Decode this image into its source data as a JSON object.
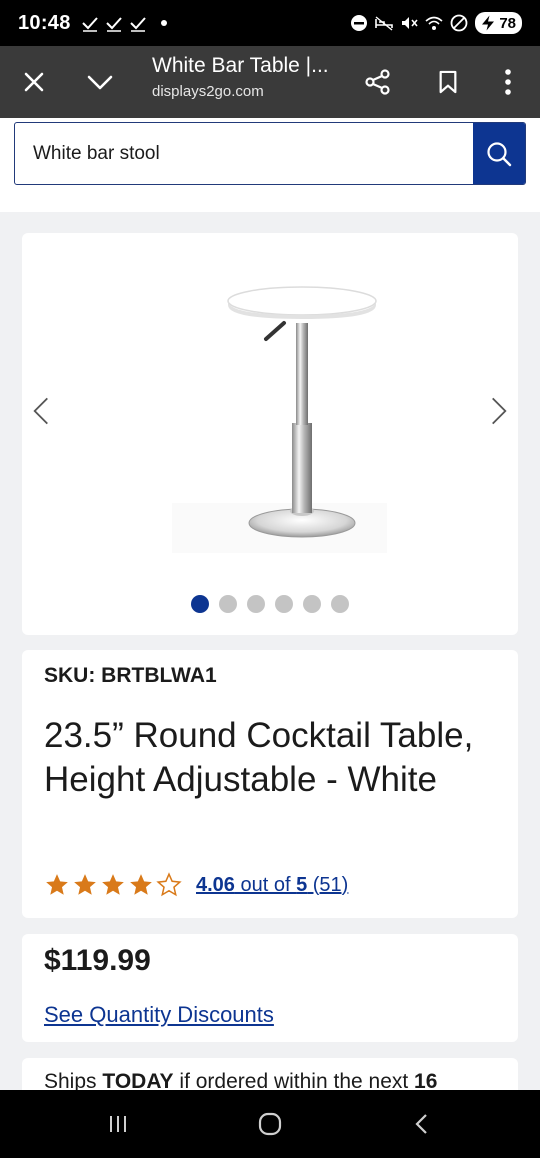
{
  "status_bar": {
    "time": "10:48",
    "battery": "78"
  },
  "tab_header": {
    "title": "White Bar Table |...",
    "url": "displays2go.com"
  },
  "search": {
    "value": "White bar stool",
    "icon": "search-icon"
  },
  "gallery": {
    "image_count": 6,
    "active_index": 0
  },
  "product": {
    "sku": "SKU: BRTBLWA1",
    "title": "23.5” Round Cocktail Table, Height Adjustable - White",
    "rating_value": "4.06",
    "rating_mid": " out of ",
    "rating_max": "5",
    "rating_count": " (51)",
    "rating_numeric": 4.06
  },
  "pricing": {
    "price": "$119.99",
    "discount_link": "See Quantity Discounts"
  },
  "shipping": {
    "prefix": "Ships ",
    "emphasis": "TODAY",
    "middle": " if ordered within the next ",
    "count": "16"
  },
  "colors": {
    "brand_blue": "#0d3591",
    "star_orange": "#d97a1a",
    "header_bg": "#3a3a3a"
  }
}
